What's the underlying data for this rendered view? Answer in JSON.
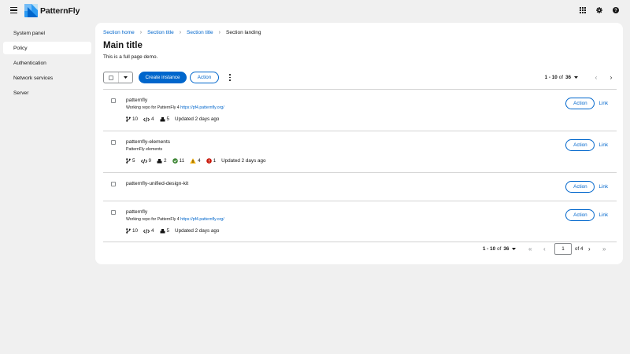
{
  "masthead": {
    "brand": "PatternFly",
    "icons": [
      "menu-icon",
      "grid-icon",
      "gear-icon",
      "help-icon"
    ]
  },
  "sidebar": {
    "items": [
      {
        "label": "System panel",
        "active": false
      },
      {
        "label": "Policy",
        "active": true
      },
      {
        "label": "Authentication",
        "active": false
      },
      {
        "label": "Network services",
        "active": false
      },
      {
        "label": "Server",
        "active": false
      }
    ]
  },
  "breadcrumb": {
    "items": [
      "Section home",
      "Section title",
      "Section title"
    ],
    "current": "Section landing"
  },
  "page": {
    "title": "Main title",
    "description": "This is a full page demo."
  },
  "toolbar": {
    "create_label": "Create instance",
    "action_label": "Action"
  },
  "pagination": {
    "range": "1 - 10",
    "of_text": "of",
    "total": "36",
    "current_page": "1",
    "page_count_text": "of 4"
  },
  "rows": [
    {
      "name": "patternfly",
      "desc_text": "Working repo for PatternFly 4",
      "desc_link": "https://pf4.patternfly.org/",
      "branches": "10",
      "code": "4",
      "cubes": "5",
      "updated": "Updated 2 days ago",
      "action_label": "Action",
      "link_label": "Link"
    },
    {
      "name": "patternfly-elements",
      "desc_text": "PatternFly elements",
      "branches": "5",
      "code": "9",
      "cubes": "2",
      "ok": "11",
      "warn": "4",
      "err": "1",
      "updated": "Updated 2 days ago",
      "action_label": "Action",
      "link_label": "Link"
    },
    {
      "name": "patternfly-unified-design-kit",
      "action_label": "Action",
      "link_label": "Link"
    },
    {
      "name": "patternfly",
      "desc_text": "Working repo for PatternFly 4",
      "desc_link": "https://pf4.patternfly.org/",
      "branches": "10",
      "code": "4",
      "cubes": "5",
      "updated": "Updated 2 days ago",
      "action_label": "Action",
      "link_label": "Link"
    }
  ],
  "colors": {
    "primary": "#0066cc",
    "success": "#3e8635",
    "warning": "#f0ab00",
    "danger": "#c9190b",
    "background": "#f0f0f0"
  }
}
